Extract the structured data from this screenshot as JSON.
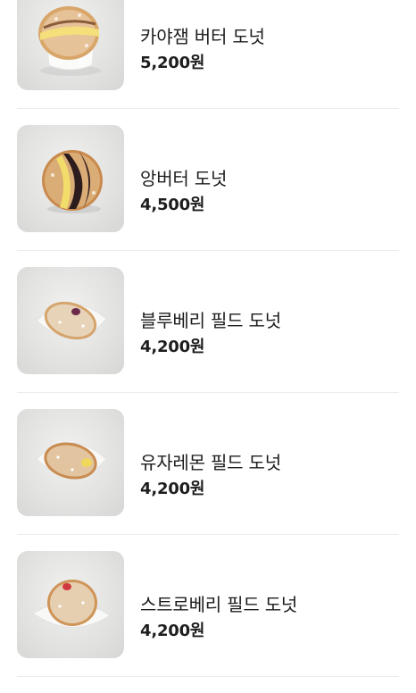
{
  "menu": {
    "items": [
      {
        "name": "카야잼 버터 도넛",
        "price": "5,200원",
        "icon": "kaya-jam-butter-donut-photo"
      },
      {
        "name": "앙버터 도넛",
        "price": "4,500원",
        "icon": "red-bean-butter-donut-photo"
      },
      {
        "name": "블루베리 필드 도넛",
        "price": "4,200원",
        "icon": "blueberry-filled-donut-photo"
      },
      {
        "name": "유자레몬 필드 도넛",
        "price": "4,200원",
        "icon": "yuzu-lemon-filled-donut-photo"
      },
      {
        "name": "스트로베리 필드 도넛",
        "price": "4,200원",
        "icon": "strawberry-filled-donut-photo"
      }
    ]
  }
}
